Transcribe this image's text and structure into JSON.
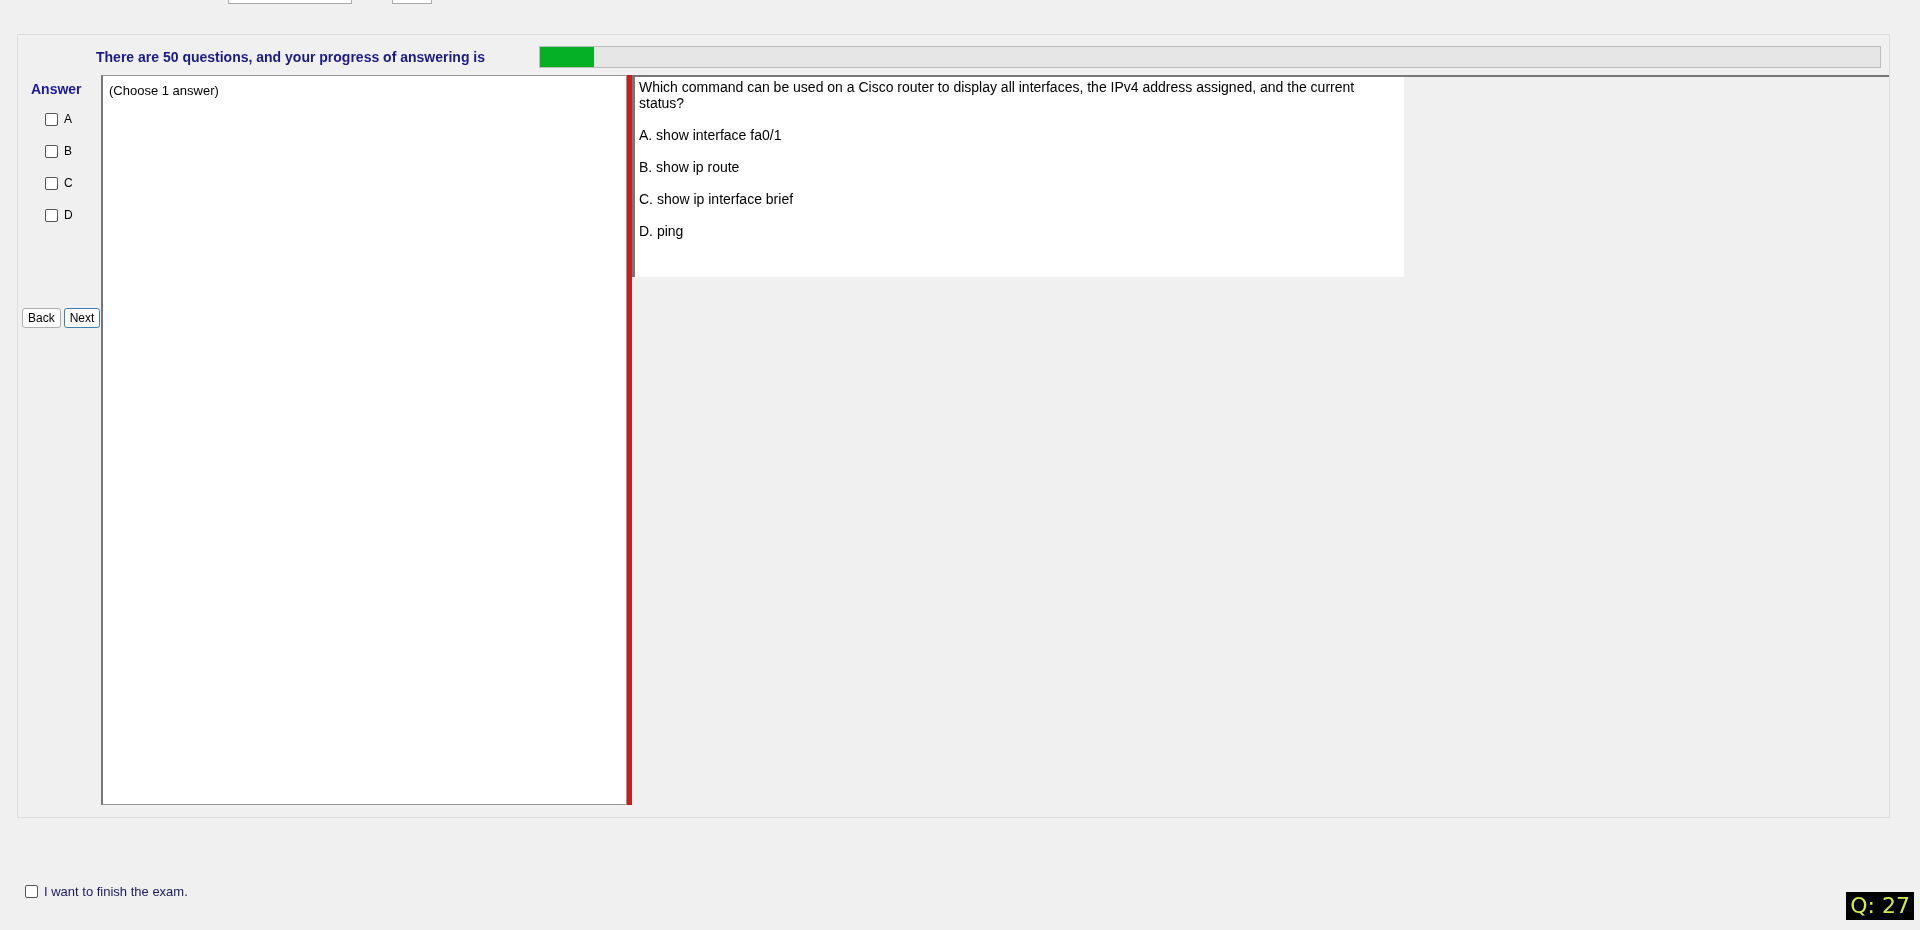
{
  "progress": {
    "label": "There are 50 questions, and your progress of answering is",
    "level": 0.04
  },
  "answer_panel": {
    "title": "Answer",
    "options": [
      {
        "label": "A",
        "checked": false
      },
      {
        "label": "B",
        "checked": false
      },
      {
        "label": "C",
        "checked": false
      },
      {
        "label": "D",
        "checked": false
      }
    ],
    "buttons": [
      {
        "label": "Back",
        "selected": false
      },
      {
        "label": "Next",
        "selected": true
      }
    ]
  },
  "instruction": "(Choose 1 answer)",
  "question": {
    "text": "Which command can be used on a Cisco router to display all interfaces, the IPv4 address assigned, and the current status?",
    "choices": [
      "A.  show interface fa0/1",
      "B.  show ip route",
      "C.  show ip interface brief",
      "D.  ping"
    ]
  },
  "finish": {
    "label": "I want to finish the exam.",
    "checked": false
  },
  "question_number": "Q: 27"
}
